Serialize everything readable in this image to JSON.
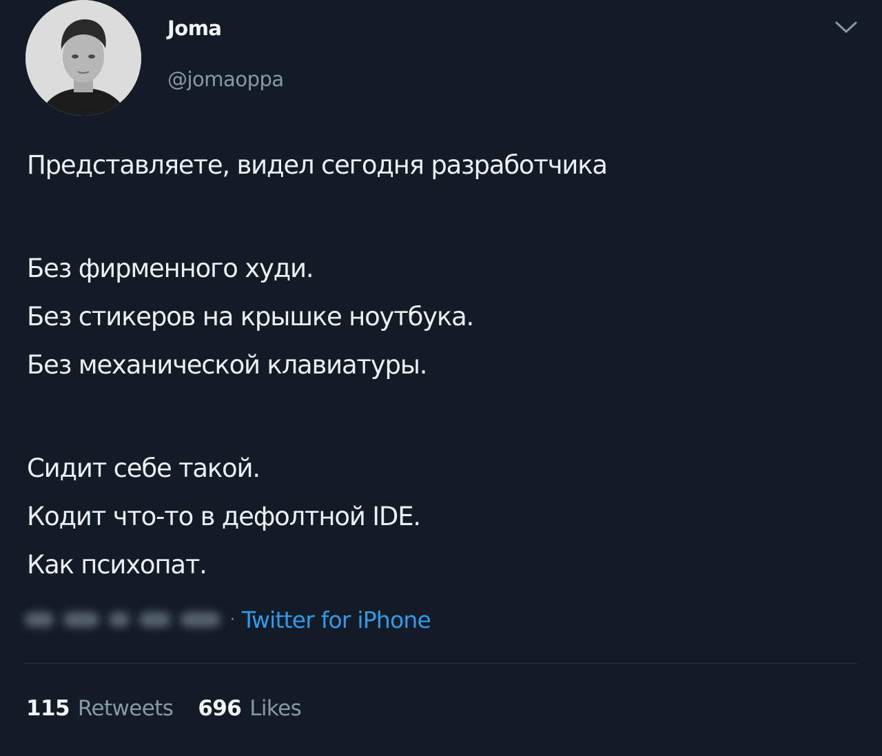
{
  "author": {
    "display_name": "Joma",
    "handle": "@jomaoppa"
  },
  "icons": {
    "menu": "chevron-down-icon"
  },
  "tweet": {
    "paragraphs": [
      [
        "Представляете, видел сегодня разработчика"
      ],
      [
        "Без фирменного худи.",
        "Без стикеров на крышке ноутбука.",
        "Без механической клавиатуры."
      ],
      [
        "Сидит себе такой.",
        "Кодит что-то в дефолтной IDE.",
        "Как психопат."
      ]
    ],
    "source": "Twitter for iPhone",
    "timestamp_redacted": true
  },
  "stats": {
    "retweets_count": "115",
    "retweets_label": "Retweets",
    "likes_count": "696",
    "likes_label": "Likes"
  },
  "colors": {
    "background": "#131b26",
    "text": "#edf0f3",
    "muted": "#8899a6",
    "link": "#2f9bea"
  }
}
